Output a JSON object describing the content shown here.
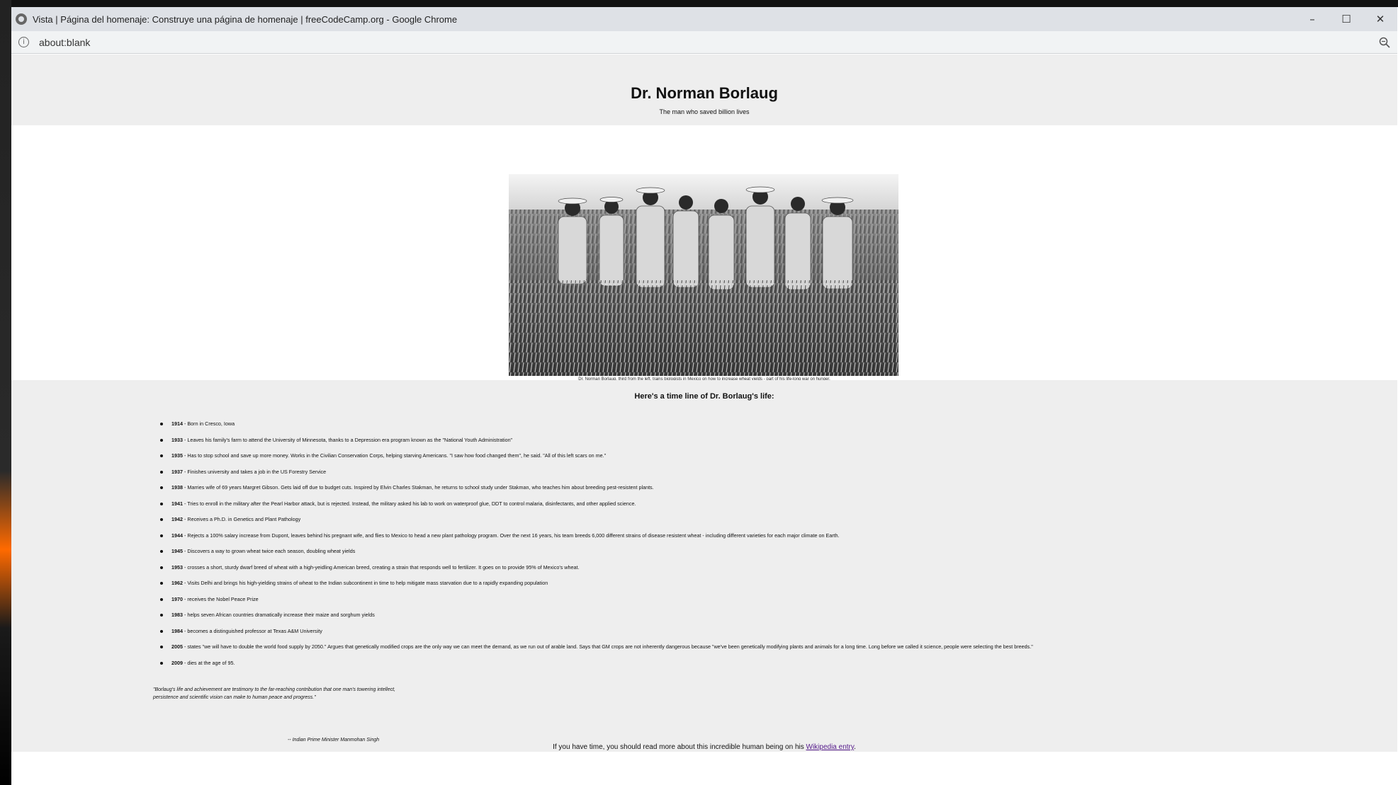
{
  "window": {
    "title": "Vista | Página del homenaje: Construye una página de homenaje | freeCodeCamp.org - Google Chrome",
    "minimize": "–",
    "maximize": "☐",
    "close": "✕"
  },
  "address": {
    "url": "about:blank",
    "info": "i"
  },
  "header": {
    "title": "Dr. Norman Borlaug",
    "subtitle": "The man who saved billion lives"
  },
  "image": {
    "caption": "Dr. Norman Borlaug, third from the left, trains biologists in Mexico on how to increase wheat yields - part of his life-long war on hunger."
  },
  "timeline": {
    "intro": "Here's a time line of Dr. Borlaug's life:",
    "items": [
      {
        "year": "1914",
        "text": " - Born in Cresco, Iowa"
      },
      {
        "year": "1933",
        "text": " - Leaves his family's farm to attend the University of Minnesota, thanks to a Depression era program known as the \"National Youth Administration\""
      },
      {
        "year": "1935",
        "text": " - Has to stop school and save up more money. Works in the Civilian Conservation Corps, helping starving Americans. \"I saw how food changed them\", he said. \"All of this left scars on me.\""
      },
      {
        "year": "1937",
        "text": " - Finishes university and takes a job in the US Forestry Service"
      },
      {
        "year": "1938",
        "text": " - Marries wife of 69 years Margret Gibson. Gets laid off due to budget cuts. Inspired by Elvin Charles Stakman, he returns to school study under Stakman, who teaches him about breeding pest-resistent plants."
      },
      {
        "year": "1941",
        "text": " - Tries to enroll in the military after the Pearl Harbor attack, but is rejected. Instead, the military asked his lab to work on waterproof glue, DDT to control malaria, disinfectants, and other applied science."
      },
      {
        "year": "1942",
        "text": " - Receives a Ph.D. in Genetics and Plant Pathology"
      },
      {
        "year": "1944",
        "text": " - Rejects a 100% salary increase from Dupont, leaves behind his pregnant wife, and flies to Mexico to head a new plant pathology program. Over the next 16 years, his team breeds 6,000 different strains of disease resistent wheat - including different varieties for each major climate on Earth."
      },
      {
        "year": "1945",
        "text": " - Discovers a way to grown wheat twice each season, doubling wheat yields"
      },
      {
        "year": "1953",
        "text": " - crosses a short, sturdy dwarf breed of wheat with a high-yeidling American breed, creating a strain that responds well to fertilizer. It goes on to provide 95% of Mexico's wheat."
      },
      {
        "year": "1962",
        "text": " - Visits Delhi and brings his high-yielding strains of wheat to the Indian subcontinent in time to help mitigate mass starvation due to a rapidly expanding population"
      },
      {
        "year": "1970",
        "text": " - receives the Nobel Peace Prize"
      },
      {
        "year": "1983",
        "text": " - helps seven African countries dramatically increase their maize and sorghum yields"
      },
      {
        "year": "1984",
        "text": " - becomes a distinguished professor at Texas A&M University"
      },
      {
        "year": "2005",
        "text": " - states \"we will have to double the world food supply by 2050.\" Argues that genetically modified crops are the only way we can meet the demand, as we run out of arable land. Says that GM crops are not inherently dangerous because \"we've been genetically modifying plants and animals for a long time. Long before we called it science, people were selecting the best breeds.\""
      },
      {
        "year": "2009",
        "text": " - dies at the age of 95."
      }
    ]
  },
  "quote": {
    "line1": "\"Borlaug's life and achievement are testimony to the far-reaching contribution that one man's towering intellect,",
    "line2": "persistence and scientific vision can make to human peace and progress.\"",
    "author": "-- Indian Prime Minister Manmohan Singh"
  },
  "footer": {
    "prefix": "If you have time, you should read more about this incredible human being on his ",
    "link": "Wikipedia entry",
    "suffix": "."
  }
}
